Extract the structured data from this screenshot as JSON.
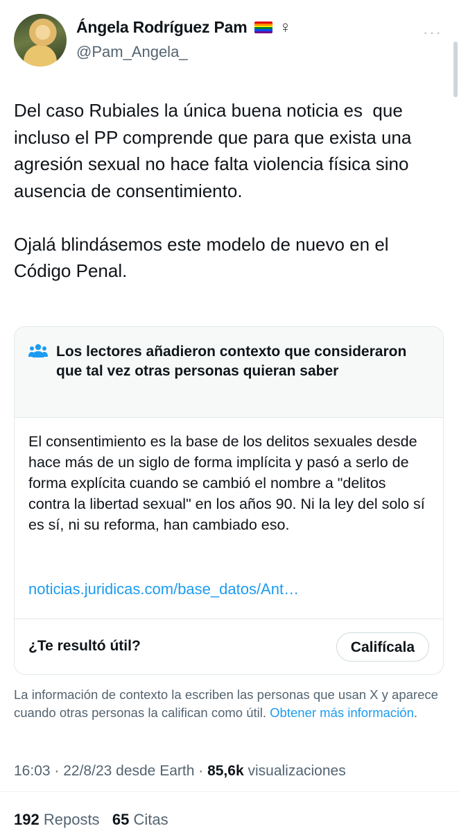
{
  "author": {
    "display_name": "Ángela Rodríguez Pam",
    "handle": "@Pam_Angela_",
    "flag_icon": "rainbow-flag-icon",
    "symbol": "♀",
    "more_label": "···"
  },
  "tweet": {
    "text": "Del caso Rubiales la única buena noticia es  que incluso el PP comprende que para que exista una agresión sexual no hace falta violencia física sino ausencia de consentimiento.\n\nOjalá blindásemos este modelo de nuevo en el Código Penal."
  },
  "community_note": {
    "title": "Los lectores añadieron contexto que consideraron que tal vez otras personas quieran saber",
    "body": "El consentimiento es la base de los delitos sexuales desde hace más de un siglo de forma implícita y pasó a serlo de forma explícita cuando se cambió el nombre a \"delitos contra la libertad sexual\" en los años 90. Ni la ley del solo sí es sí, ni su reforma, han cambiado eso.",
    "link_text": "noticias.juridicas.com/base_datos/Ant…",
    "helpful_question": "¿Te resultó útil?",
    "rate_button": "Califícala"
  },
  "info": {
    "text": "La información de contexto la escriben las personas que usan X y aparece cuando otras personas la califican como útil.",
    "link": "Obtener más información",
    "link_suffix": "."
  },
  "meta": {
    "time": "16:03",
    "sep1": " · ",
    "date": "22/8/23",
    "source": " desde Earth",
    "sep2": " · ",
    "views_count": "85,6k",
    "views_label": " visualizaciones"
  },
  "stats": {
    "reposts_count": "192",
    "reposts_label": "Reposts",
    "quotes_count": "65",
    "quotes_label": "Citas"
  },
  "colors": {
    "accent": "#1d9bf0",
    "secondary_text": "#536471",
    "flag": [
      "#e40303",
      "#ff8c00",
      "#ffed00",
      "#008026",
      "#004dff",
      "#750787"
    ]
  }
}
